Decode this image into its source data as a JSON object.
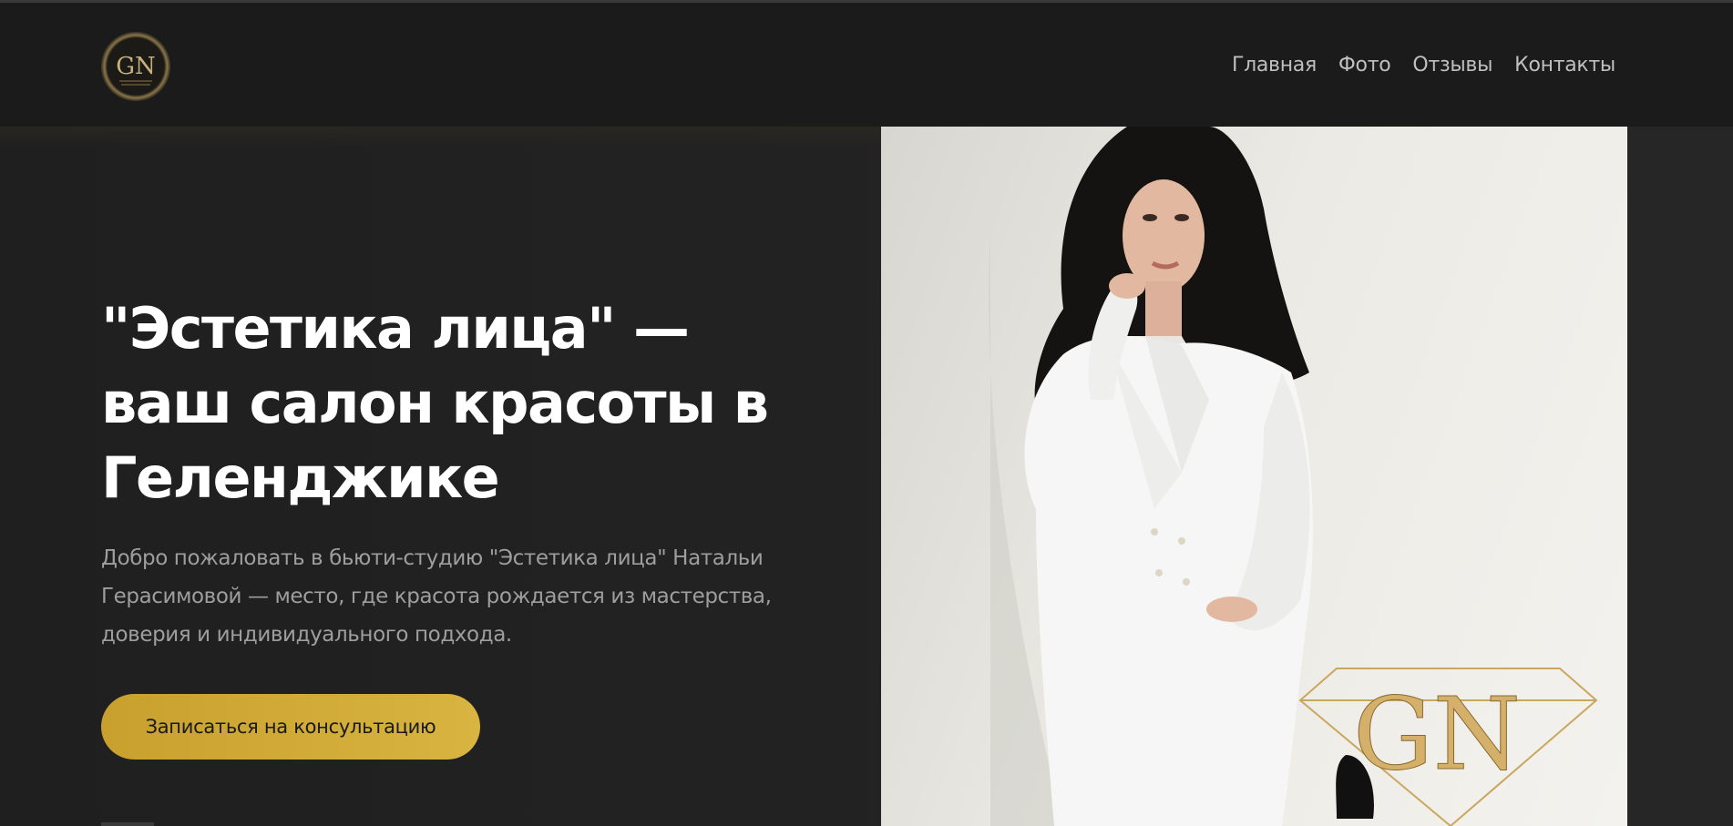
{
  "nav": {
    "items": [
      {
        "label": "Главная"
      },
      {
        "label": "Фото"
      },
      {
        "label": "Отзывы"
      },
      {
        "label": "Контакты"
      }
    ]
  },
  "hero": {
    "title": "\"Эстетика лица\" — ваш салон красоты в Геленджике",
    "description": "Добро пожаловать в бьюти-студию \"Эстетика лица\" Натальи Герасимовой — место, где красота рождается из мастерства, доверия и индивидуального подхода.",
    "cta_label": "Записаться на консультацию"
  },
  "logo": {
    "monogram": "GN"
  },
  "colors": {
    "accent": "#d1aa36",
    "background": "#202020",
    "header": "#1b1b1b",
    "text_primary": "#ffffff",
    "text_secondary": "#9e9e9e"
  }
}
